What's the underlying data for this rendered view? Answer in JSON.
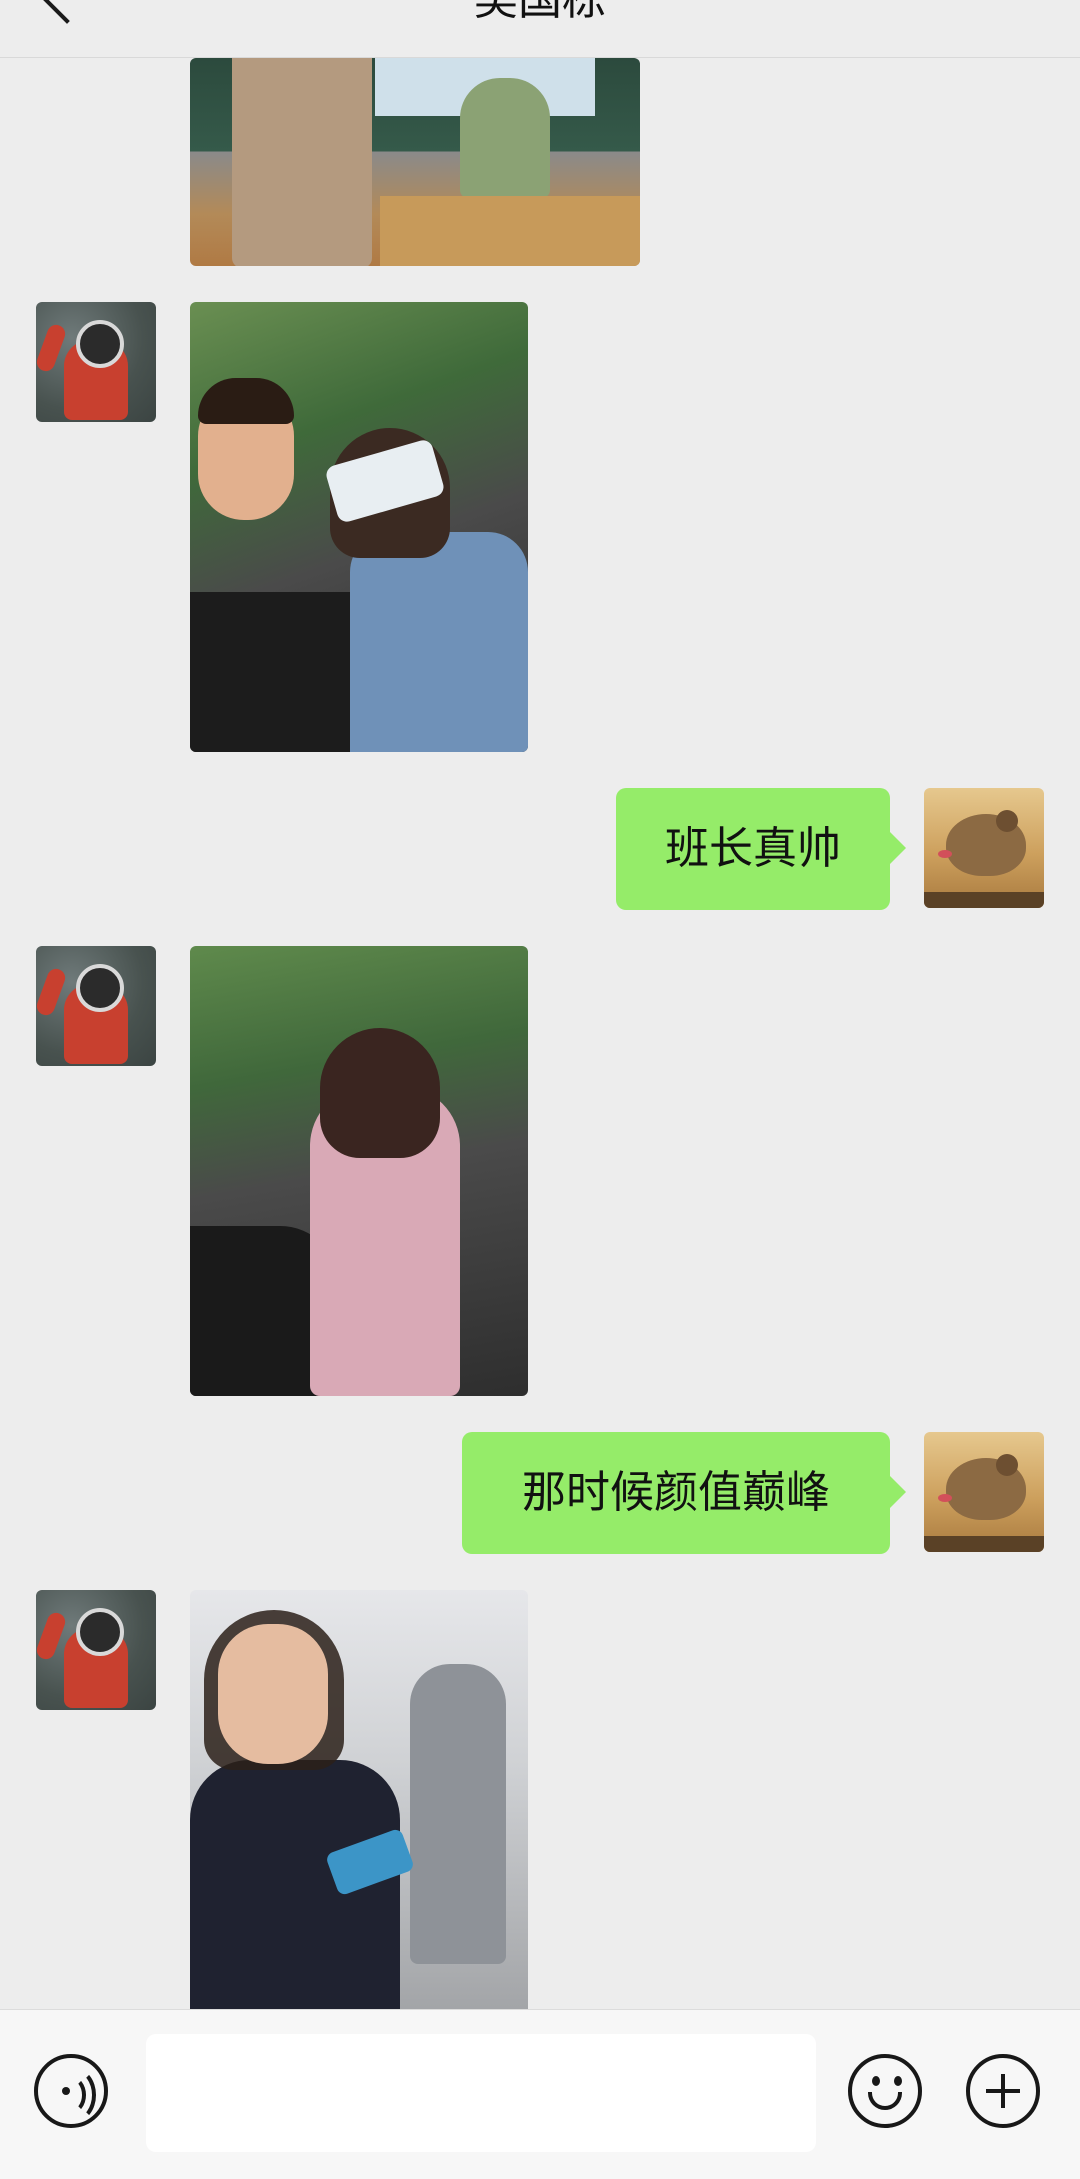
{
  "header": {
    "title": "吴国栋"
  },
  "messages": [
    {
      "side": "left",
      "type": "image",
      "content": "classroom photo"
    },
    {
      "side": "left",
      "type": "image",
      "content": "selfie photo"
    },
    {
      "side": "right",
      "type": "text",
      "text": "班长真帅"
    },
    {
      "side": "left",
      "type": "image",
      "content": "photo"
    },
    {
      "side": "right",
      "type": "text",
      "text": "那时候颜值巅峰"
    },
    {
      "side": "left",
      "type": "image",
      "content": "hallway photo"
    }
  ],
  "icons": {
    "back": "chevron-left-icon",
    "voice": "voice-icon",
    "emoji": "emoji-icon",
    "plus": "plus-icon"
  },
  "input": {
    "value": "",
    "placeholder": ""
  },
  "colors": {
    "background": "#ededed",
    "bubble_self": "#95ec69",
    "input_bar": "#f7f7f7"
  }
}
